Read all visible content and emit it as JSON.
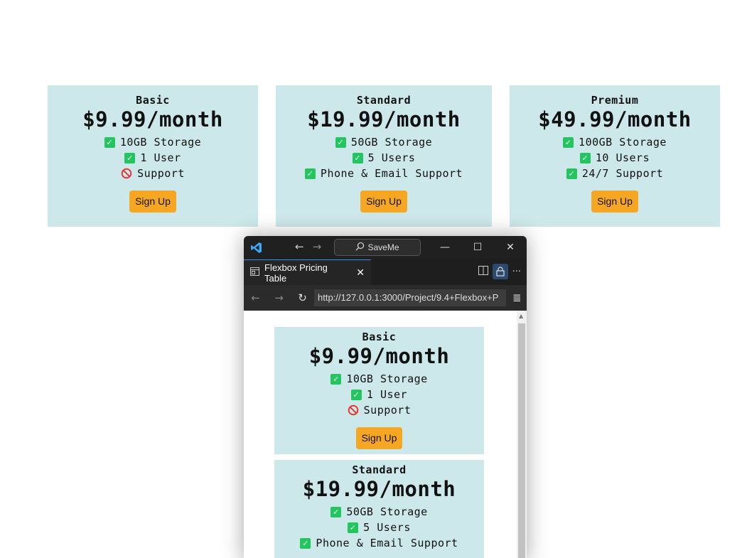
{
  "plans": [
    {
      "name": "Basic",
      "price": "$9.99/month",
      "features": [
        {
          "text": "10GB Storage",
          "status": "check"
        },
        {
          "text": "1 User",
          "status": "check"
        },
        {
          "text": "Support",
          "status": "no"
        }
      ],
      "button": "Sign Up"
    },
    {
      "name": "Standard",
      "price": "$19.99/month",
      "features": [
        {
          "text": "50GB Storage",
          "status": "check"
        },
        {
          "text": "5 Users",
          "status": "check"
        },
        {
          "text": "Phone & Email Support",
          "status": "check"
        }
      ],
      "button": "Sign Up"
    },
    {
      "name": "Premium",
      "price": "$49.99/month",
      "features": [
        {
          "text": "100GB Storage",
          "status": "check"
        },
        {
          "text": "10 Users",
          "status": "check"
        },
        {
          "text": "24/7 Support",
          "status": "check"
        }
      ],
      "button": "Sign Up"
    }
  ],
  "browser": {
    "command_center": "SaveMe",
    "tab_title": "Flexbox Pricing Table",
    "url": "http://127.0.0.1:3000/Project/9.4+Flexbox+P"
  },
  "colors": {
    "card_bg": "#cde8ea",
    "button_bg": "#f5a623",
    "check": "#22c55e",
    "no": "#e53935"
  }
}
